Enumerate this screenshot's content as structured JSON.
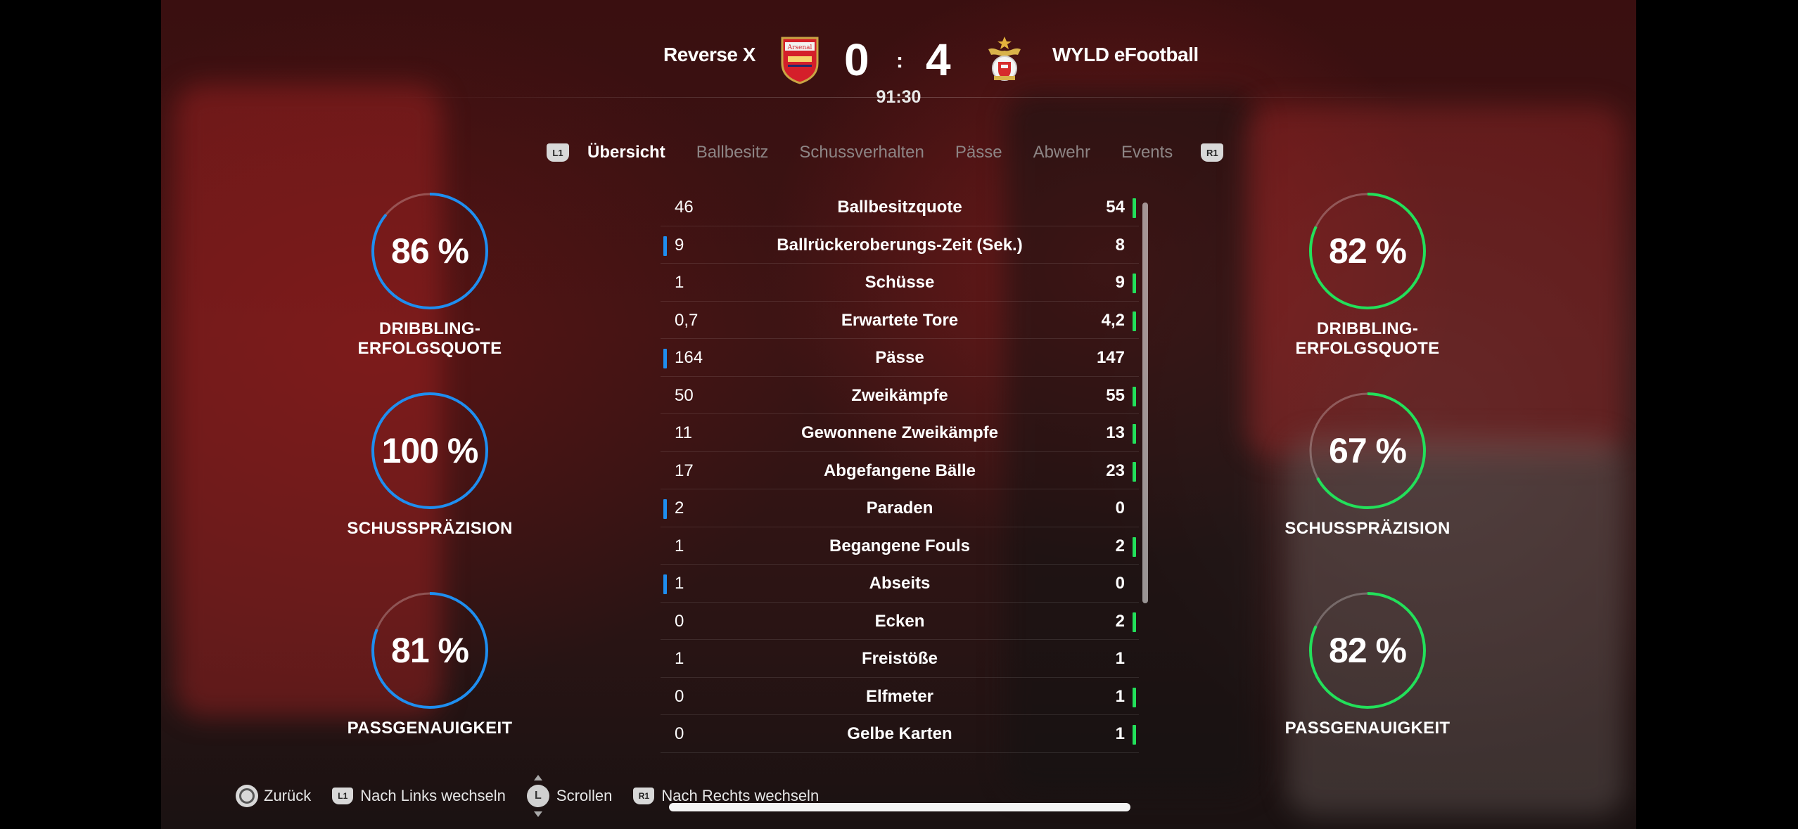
{
  "header": {
    "home_team": "Reverse X",
    "away_team": "WYLD eFootball",
    "home_score": "0",
    "separator": ":",
    "away_score": "4",
    "clock": "91:30",
    "home_crest_text": "Arsenal"
  },
  "tabs": {
    "left_button": "L1",
    "right_button": "R1",
    "items": [
      {
        "label": "Übersicht",
        "active": true
      },
      {
        "label": "Ballbesitz",
        "active": false
      },
      {
        "label": "Schussverhalten",
        "active": false
      },
      {
        "label": "Pässe",
        "active": false
      },
      {
        "label": "Abwehr",
        "active": false
      },
      {
        "label": "Events",
        "active": false
      }
    ]
  },
  "gauges": {
    "home": [
      {
        "value": 86,
        "text": "86 %",
        "label": "DRIBBLING-ERFOLGSQUOTE"
      },
      {
        "value": 100,
        "text": "100 %",
        "label": "SCHUSSPRÄZISION"
      },
      {
        "value": 81,
        "text": "81 %",
        "label": "PASSGENAUIGKEIT"
      }
    ],
    "away": [
      {
        "value": 82,
        "text": "82 %",
        "label": "DRIBBLING-ERFOLGSQUOTE"
      },
      {
        "value": 67,
        "text": "67 %",
        "label": "SCHUSSPRÄZISION"
      },
      {
        "value": 82,
        "text": "82 %",
        "label": "PASSGENAUIGKEIT"
      }
    ],
    "home_color": "#1e8ef0",
    "away_color": "#22e05a"
  },
  "stats": [
    {
      "left": "46",
      "name": "Ballbesitzquote",
      "right": "54",
      "leader": "right"
    },
    {
      "left": "9",
      "name": "Ballrückeroberungs-Zeit (Sek.)",
      "right": "8",
      "leader": "left"
    },
    {
      "left": "1",
      "name": "Schüsse",
      "right": "9",
      "leader": "right"
    },
    {
      "left": "0,7",
      "name": "Erwartete Tore",
      "right": "4,2",
      "leader": "right"
    },
    {
      "left": "164",
      "name": "Pässe",
      "right": "147",
      "leader": "left"
    },
    {
      "left": "50",
      "name": "Zweikämpfe",
      "right": "55",
      "leader": "right"
    },
    {
      "left": "11",
      "name": "Gewonnene Zweikämpfe",
      "right": "13",
      "leader": "right"
    },
    {
      "left": "17",
      "name": "Abgefangene Bälle",
      "right": "23",
      "leader": "right"
    },
    {
      "left": "2",
      "name": "Paraden",
      "right": "0",
      "leader": "left"
    },
    {
      "left": "1",
      "name": "Begangene Fouls",
      "right": "2",
      "leader": "right"
    },
    {
      "left": "1",
      "name": "Abseits",
      "right": "0",
      "leader": "left"
    },
    {
      "left": "0",
      "name": "Ecken",
      "right": "2",
      "leader": "right"
    },
    {
      "left": "1",
      "name": "Freistöße",
      "right": "1",
      "leader": "none"
    },
    {
      "left": "0",
      "name": "Elfmeter",
      "right": "1",
      "leader": "right"
    },
    {
      "left": "0",
      "name": "Gelbe Karten",
      "right": "1",
      "leader": "right"
    }
  ],
  "footer": {
    "back": "Zurück",
    "l1_badge": "L1",
    "switch_left": "Nach Links wechseln",
    "stick_badge": "L",
    "scroll": "Scrollen",
    "r1_badge": "R1",
    "switch_right": "Nach Rechts wechseln"
  }
}
